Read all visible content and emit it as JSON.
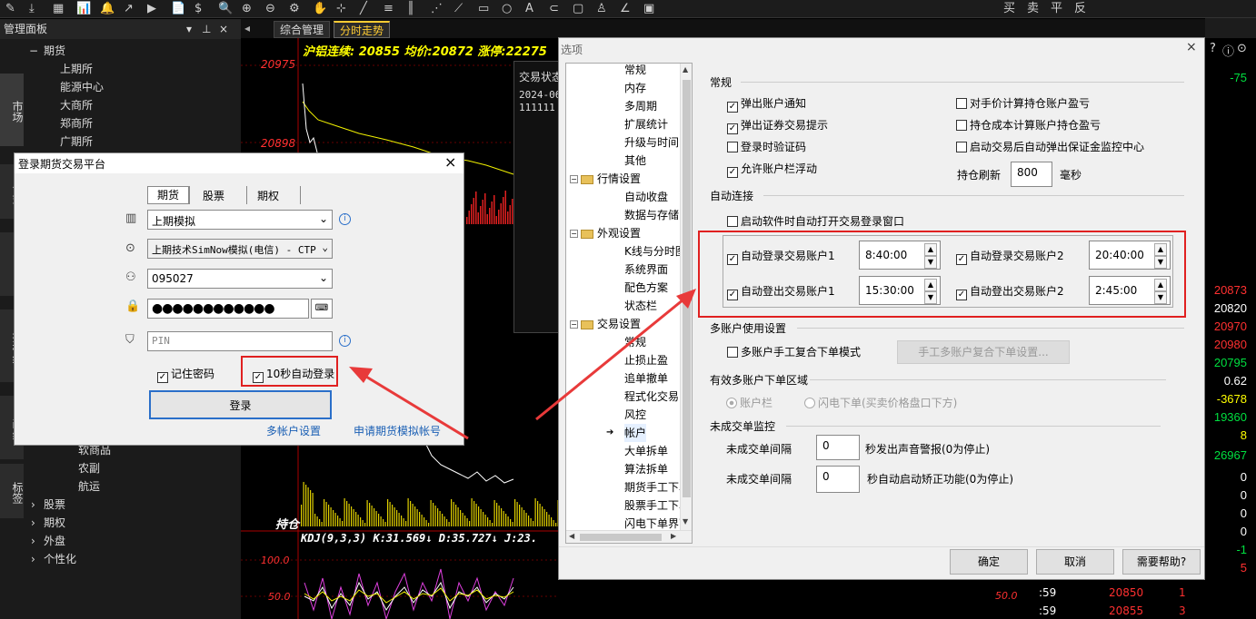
{
  "toolbar": {
    "items": [
      "✎",
      "⤓",
      "▦",
      "📊",
      "🔔",
      "↗",
      "▶",
      "📄",
      "$",
      "🔍",
      "⊕",
      "⊖",
      "⚙",
      "✋",
      "⊹",
      "╱",
      "≡",
      "║",
      "⋰",
      "⟋",
      "▭",
      "○",
      "A",
      "⊂",
      "▢",
      "♙",
      "∠",
      "▣"
    ],
    "trade": [
      "买",
      "卖",
      "平",
      "反"
    ]
  },
  "tabs": [
    "综合管理",
    "分时走势"
  ],
  "panel": {
    "title": "管理面板",
    "vtabs": [
      "市场",
      "公式",
      "VBA",
      "指标组",
      "画线",
      "标签"
    ],
    "tree_top": [
      {
        "label": "期货",
        "indent": 0
      },
      {
        "label": "上期所",
        "indent": 1
      },
      {
        "label": "能源中心",
        "indent": 1
      },
      {
        "label": "大商所",
        "indent": 1
      },
      {
        "label": "郑商所",
        "indent": 1
      },
      {
        "label": "广期所",
        "indent": 1
      }
    ],
    "tree_bottom": [
      {
        "label": "软商品",
        "indent": 1
      },
      {
        "label": "农副",
        "indent": 1
      },
      {
        "label": "航运",
        "indent": 1
      },
      {
        "label": "股票",
        "indent": 0
      },
      {
        "label": "期权",
        "indent": 0
      },
      {
        "label": "外盘",
        "indent": 0
      },
      {
        "label": "个性化",
        "indent": 0
      }
    ]
  },
  "chart": {
    "header": "沪铝连续: 20855 均价:20872 涨停:22275",
    "y_top": "20975",
    "y_mid": "20898",
    "popup_title": "交易状态",
    "popup_lines": [
      "2024-06",
      "111111"
    ],
    "hold_label": "持仓",
    "kdj": "KDJ(9,3,3) K:31.569↓ D:35.727↓ J:23.",
    "k100": "100.0",
    "k50": "50.0",
    "k50r": "50.0"
  },
  "right": {
    "top": "-75",
    "values": [
      {
        "v": "20873",
        "c": "#ff3030"
      },
      {
        "v": "20820",
        "c": "#ffffff"
      },
      {
        "v": "20970",
        "c": "#ff3030"
      },
      {
        "v": "20980",
        "c": "#ff3030"
      },
      {
        "v": "20795",
        "c": "#00e040"
      },
      {
        "v": "0.62",
        "c": "#ffffff"
      },
      {
        "v": "-3678",
        "c": "#ffff00"
      },
      {
        "v": "19360",
        "c": "#00e040"
      },
      {
        "v": "8",
        "c": "#ffff00"
      },
      {
        "v": "26967",
        "c": "#00e040"
      },
      {
        "v": "0",
        "c": "#ffffff"
      },
      {
        "v": "0",
        "c": "#ffffff"
      },
      {
        "v": "0",
        "c": "#ffffff"
      },
      {
        "v": "0",
        "c": "#ffffff"
      },
      {
        "v": "-1",
        "c": "#00e040"
      },
      {
        "v": "5",
        "c": "#ff3030"
      },
      {
        "v": "-1",
        "c": "#00e040"
      },
      {
        "v": "0",
        "c": "#ffffff"
      }
    ],
    "bottom_rows": [
      [
        ":59",
        "20850",
        "1"
      ],
      [
        ":59",
        "20855",
        "3"
      ]
    ]
  },
  "options": {
    "title": "选项",
    "close": "×",
    "tree": [
      {
        "t": "常规",
        "l": 2
      },
      {
        "t": "内存",
        "l": 2
      },
      {
        "t": "多周期",
        "l": 2
      },
      {
        "t": "扩展统计",
        "l": 2
      },
      {
        "t": "升级与时间",
        "l": 2
      },
      {
        "t": "其他",
        "l": 2
      },
      {
        "t": "行情设置",
        "l": 1
      },
      {
        "t": "自动收盘",
        "l": 2
      },
      {
        "t": "数据与存储",
        "l": 2
      },
      {
        "t": "外观设置",
        "l": 1
      },
      {
        "t": "K线与分时图",
        "l": 2
      },
      {
        "t": "系统界面",
        "l": 2
      },
      {
        "t": "配色方案",
        "l": 2
      },
      {
        "t": "状态栏",
        "l": 2
      },
      {
        "t": "交易设置",
        "l": 1
      },
      {
        "t": "常规",
        "l": 2
      },
      {
        "t": "止损止盈",
        "l": 2
      },
      {
        "t": "追单撤单",
        "l": 2
      },
      {
        "t": "程式化交易",
        "l": 2
      },
      {
        "t": "风控",
        "l": 2
      },
      {
        "t": "帐户",
        "l": 2,
        "sel": true
      },
      {
        "t": "大单拆单",
        "l": 2
      },
      {
        "t": "算法拆单",
        "l": 2
      },
      {
        "t": "期货手工下单",
        "l": 2
      },
      {
        "t": "股票手工下单",
        "l": 2
      },
      {
        "t": "闪电下单界面",
        "l": 2
      }
    ],
    "sec_general": "常规",
    "general_left": [
      {
        "t": "弹出账户通知",
        "c": true
      },
      {
        "t": "弹出证券交易提示",
        "c": true
      },
      {
        "t": "登录时验证码",
        "c": false
      },
      {
        "t": "允许账户栏浮动",
        "c": true
      }
    ],
    "general_right": [
      {
        "t": "对手价计算持仓账户盈亏",
        "c": false
      },
      {
        "t": "持仓成本计算账户持仓盈亏",
        "c": false
      },
      {
        "t": "启动交易后自动弹出保证金监控中心",
        "c": false
      }
    ],
    "refresh_label": "持仓刷新",
    "refresh_value": "800",
    "refresh_unit": "毫秒",
    "sec_auto": "自动连接",
    "auto_open": "启动软件时自动打开交易登录窗口",
    "auto_rows": [
      {
        "t": "自动登录交易账户1",
        "v": "8:40:00"
      },
      {
        "t": "自动登录交易账户2",
        "v": "20:40:00"
      },
      {
        "t": "自动登出交易账户1",
        "v": "15:30:00"
      },
      {
        "t": "自动登出交易账户2",
        "v": "2:45:00"
      }
    ],
    "sec_multi": "多账户使用设置",
    "multi_cb": "多账户手工复合下单模式",
    "multi_btn": "手工多账户复合下单设置...",
    "sec_zone": "有效多账户下单区域",
    "zone_r1": "账户栏",
    "zone_r2": "闪电下单(买卖价格盘口下方)",
    "sec_pending": "未成交单监控",
    "pend1_label": "未成交单间隔",
    "pend1_value": "0",
    "pend1_desc": "秒发出声音警报(0为停止)",
    "pend2_label": "未成交单间隔",
    "pend2_value": "0",
    "pend2_desc": "秒自动启动矫正功能(0为停止)",
    "ok": "确定",
    "cancel": "取消",
    "help": "需要帮助?"
  },
  "login": {
    "title": "登录期货交易平台",
    "close": "×",
    "tabs": [
      "期货",
      "股票",
      "期权"
    ],
    "broker": "上期模拟",
    "server": "上期技术SimNow模拟(电信) - CTP",
    "account": "095027",
    "password": "●●●●●●●●●●●●",
    "pin_placeholder": "PIN",
    "remember": "记住密码",
    "autologin": "10秒自动登录",
    "login_btn": "登录",
    "link1": "多帐户设置",
    "link2": "申请期货模拟帐号"
  }
}
